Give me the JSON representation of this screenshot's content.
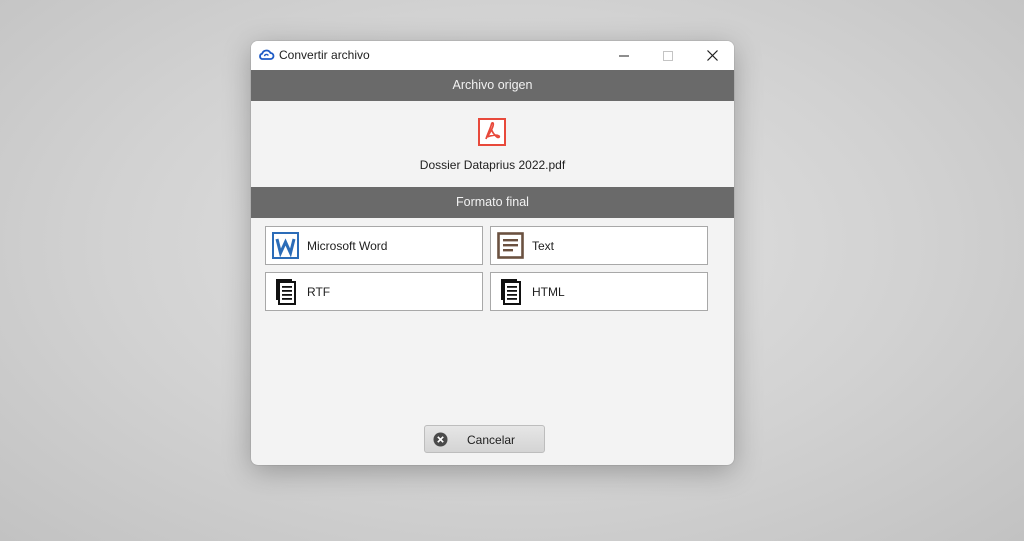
{
  "window": {
    "title": "Convertir archivo",
    "controls": [
      "minimize-icon",
      "maximize-icon",
      "close-icon"
    ]
  },
  "origin": {
    "header": "Archivo origen",
    "file_icon": "pdf-icon",
    "file_name": "Dossier Dataprius 2022.pdf"
  },
  "target": {
    "header": "Formato final",
    "formats": [
      {
        "label": "Microsoft Word",
        "icon": "word-icon"
      },
      {
        "label": "Text",
        "icon": "text-document-icon"
      },
      {
        "label": "RTF",
        "icon": "document-icon"
      },
      {
        "label": "HTML",
        "icon": "document-icon"
      }
    ]
  },
  "actions": {
    "cancel_label": "Cancelar",
    "cancel_icon": "cancel-icon"
  },
  "colors": {
    "header_bg": "#6a6a6a",
    "pdf_red": "#e8493b",
    "word_blue": "#2b6cb8",
    "text_brown": "#6b5140",
    "cloud_blue": "#1e5bc6"
  }
}
